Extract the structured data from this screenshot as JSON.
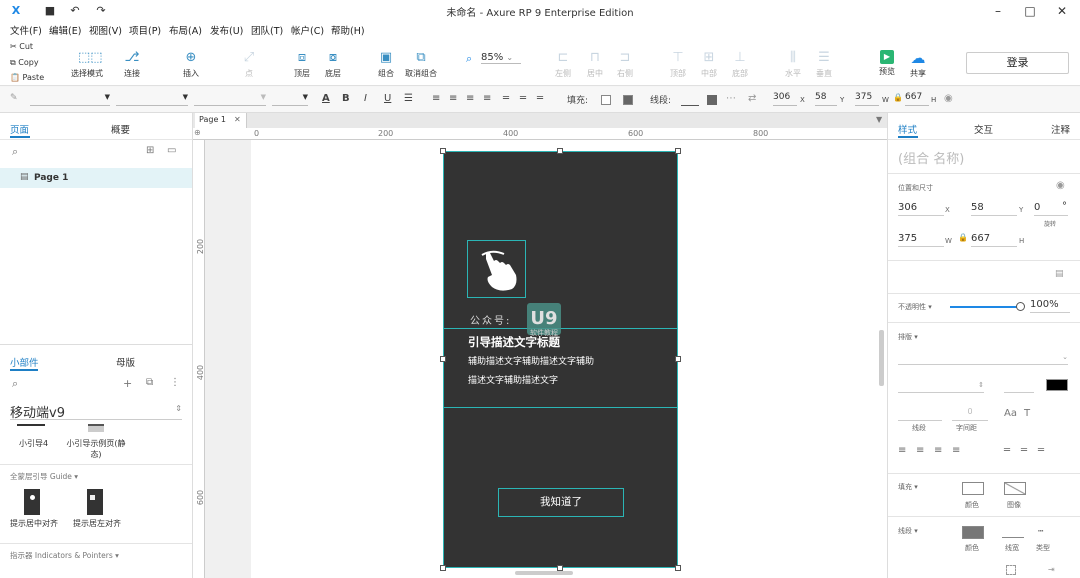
{
  "window": {
    "title": "未命名 - Axure RP 9 Enterprise Edition"
  },
  "menu": [
    "文件(F)",
    "编辑(E)",
    "视图(V)",
    "项目(P)",
    "布局(A)",
    "发布(U)",
    "团队(T)",
    "帐户(C)",
    "帮助(H)"
  ],
  "clipboard": {
    "cut": "Cut",
    "copy": "Copy",
    "paste": "Paste"
  },
  "toolbar": {
    "select_mode": "选择模式",
    "connect": "连接",
    "insert": "插入",
    "point": "点",
    "top": "顶层",
    "bottom": "底层",
    "group": "组合",
    "ungroup": "取消组合",
    "zoom": "85%",
    "align_left": "左侧",
    "align_center": "居中",
    "align_right": "右侧",
    "align_top": "顶部",
    "align_middle": "中部",
    "align_bottom": "底部",
    "dist_h": "水平",
    "dist_v": "垂直",
    "preview": "预览",
    "share": "共享",
    "login": "登录"
  },
  "formatbar": {
    "fill_label": "填充:",
    "stroke_label": "线段:",
    "x": "306",
    "y": "58",
    "w": "375",
    "h": "667",
    "x_lbl": "X",
    "y_lbl": "Y",
    "w_lbl": "W",
    "h_lbl": "H"
  },
  "left": {
    "tabs": [
      "页面",
      "概要"
    ],
    "pages": [
      "Page 1"
    ],
    "widget_tabs": [
      "小部件",
      "母版"
    ],
    "library": "移动端v9",
    "widgets_top": [
      "小引导4",
      "小引导示例页(静态)"
    ],
    "section_guide": "全蒙层引导 Guide ▾",
    "widgets_guide": [
      "提示居中对齐",
      "提示居左对齐"
    ],
    "section_indicators": "指示器 Indicators & Pointers ▾"
  },
  "canvas": {
    "tab": "Page 1",
    "ruler_h": [
      "0",
      "200",
      "400",
      "600",
      "800"
    ],
    "ruler_v": [
      "200",
      "400",
      "600"
    ],
    "phone": {
      "title": "引导描述文字标题",
      "desc1": "辅助描述文字辅助描述文字辅助",
      "desc2": "描述文字辅助描述文字",
      "button": "我知道了",
      "watermark_prefix": "公众号:",
      "watermark_logo": "U9",
      "watermark_sub": "软件教程"
    },
    "phone_bg": "#333333",
    "accent": "#2bb5b5"
  },
  "right": {
    "tabs": [
      "样式",
      "交互",
      "注释"
    ],
    "name_placeholder": "(组合 名称)",
    "pos_size": "位置和尺寸",
    "x": "306",
    "y": "58",
    "rot": "0",
    "deg": "°",
    "rot_lbl": "旋转",
    "w": "375",
    "h": "667",
    "x_lbl": "X",
    "y_lbl": "Y",
    "w_lbl": "W",
    "h_lbl": "H",
    "opacity_label": "不透明性 ▾",
    "opacity": "100%",
    "typo_label": "排版 ▾",
    "stroke_seg": "线段",
    "char_spacing": "字间距",
    "char_spacing_val": "0",
    "fill_label": "填充 ▾",
    "fill_color": "颜色",
    "fill_image": "图像",
    "stroke_label": "线段 ▾",
    "stroke_color": "颜色",
    "stroke_width": "线宽",
    "stroke_type": "类型"
  }
}
